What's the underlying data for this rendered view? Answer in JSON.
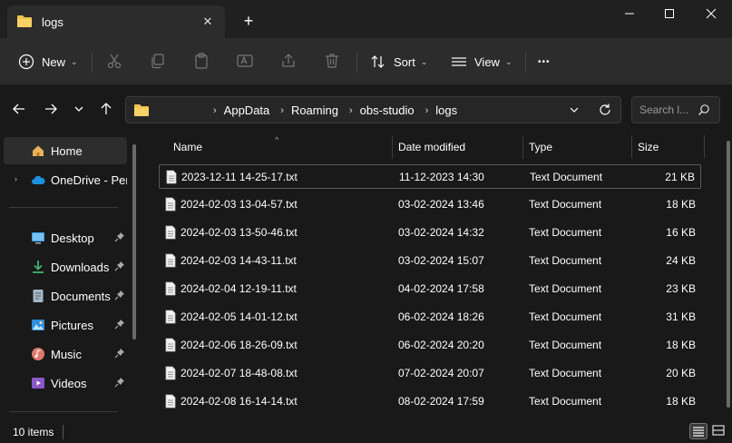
{
  "window": {
    "tab_title": "logs",
    "close_tab": "✕",
    "new_tab": "+"
  },
  "toolbar": {
    "new_label": "New",
    "sort_label": "Sort",
    "view_label": "View",
    "more_label": "•••"
  },
  "address": {
    "breadcrumbs": [
      "AppData",
      "Roaming",
      "obs-studio",
      "logs"
    ],
    "search_placeholder": "Search l..."
  },
  "sidebar": {
    "items": [
      {
        "label": "Home",
        "icon": "home-icon"
      },
      {
        "label": "OneDrive - Perso",
        "icon": "cloud-icon"
      },
      {
        "label": "Desktop",
        "icon": "desktop-icon"
      },
      {
        "label": "Downloads",
        "icon": "download-icon"
      },
      {
        "label": "Documents",
        "icon": "document-icon"
      },
      {
        "label": "Pictures",
        "icon": "picture-icon"
      },
      {
        "label": "Music",
        "icon": "music-icon"
      },
      {
        "label": "Videos",
        "icon": "video-icon"
      }
    ]
  },
  "columns": {
    "name": "Name",
    "date": "Date modified",
    "type": "Type",
    "size": "Size"
  },
  "files": [
    {
      "name": "2023-12-11 14-25-17.txt",
      "date": "11-12-2023 14:30",
      "type": "Text Document",
      "size": "21 KB"
    },
    {
      "name": "2024-02-03 13-04-57.txt",
      "date": "03-02-2024 13:46",
      "type": "Text Document",
      "size": "18 KB"
    },
    {
      "name": "2024-02-03 13-50-46.txt",
      "date": "03-02-2024 14:32",
      "type": "Text Document",
      "size": "16 KB"
    },
    {
      "name": "2024-02-03 14-43-11.txt",
      "date": "03-02-2024 15:07",
      "type": "Text Document",
      "size": "24 KB"
    },
    {
      "name": "2024-02-04 12-19-11.txt",
      "date": "04-02-2024 17:58",
      "type": "Text Document",
      "size": "23 KB"
    },
    {
      "name": "2024-02-05 14-01-12.txt",
      "date": "06-02-2024 18:26",
      "type": "Text Document",
      "size": "31 KB"
    },
    {
      "name": "2024-02-06 18-26-09.txt",
      "date": "06-02-2024 20:20",
      "type": "Text Document",
      "size": "18 KB"
    },
    {
      "name": "2024-02-07 18-48-08.txt",
      "date": "07-02-2024 20:07",
      "type": "Text Document",
      "size": "20 KB"
    },
    {
      "name": "2024-02-08 16-14-14.txt",
      "date": "08-02-2024 17:59",
      "type": "Text Document",
      "size": "18 KB"
    }
  ],
  "status": {
    "item_count": "10 items"
  },
  "colors": {
    "background": "#191919",
    "toolbar": "#2c2c2c",
    "folder_yellow": "#f0c44c",
    "onedrive_blue": "#1e8fe1"
  }
}
